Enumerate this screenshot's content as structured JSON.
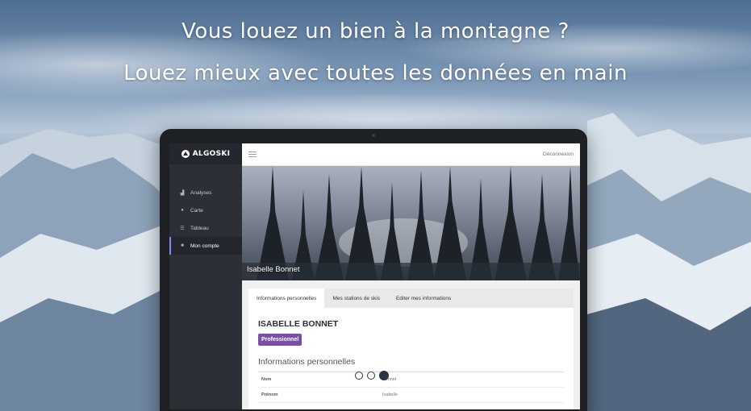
{
  "hero": {
    "title": "Vous louez un bien à la montagne ?",
    "subtitle": "Louez mieux avec toutes les données en main"
  },
  "app": {
    "brand": "ALGOSKI",
    "logout_label": "Déconnexion",
    "sidebar": {
      "items": [
        {
          "label": "Analyses",
          "icon": "bar-chart-icon",
          "active": false
        },
        {
          "label": "Carte",
          "icon": "map-pin-icon",
          "active": false
        },
        {
          "label": "Tableau",
          "icon": "list-icon",
          "active": false
        },
        {
          "label": "Mon compte",
          "icon": "user-icon",
          "active": true
        }
      ]
    },
    "profile": {
      "banner_name": "Isabelle Bonnet",
      "tabs": [
        {
          "label": "Informations personnelles",
          "active": true
        },
        {
          "label": "Mes stations de skis",
          "active": false
        },
        {
          "label": "Editer mes informations",
          "active": false
        }
      ],
      "full_name": "ISABELLE BONNET",
      "badge": "Professionnel",
      "section_title": "Informations personnelles",
      "fields": [
        {
          "key": "Nom",
          "value": "Bonnet"
        },
        {
          "key": "Prénom",
          "value": "Isabelle"
        }
      ]
    }
  },
  "carousel": {
    "count": 3,
    "active_index": 2
  },
  "colors": {
    "badge": "#7b4fa6",
    "sidebar": "#2c2f36",
    "dot_active": "#2d3344"
  }
}
